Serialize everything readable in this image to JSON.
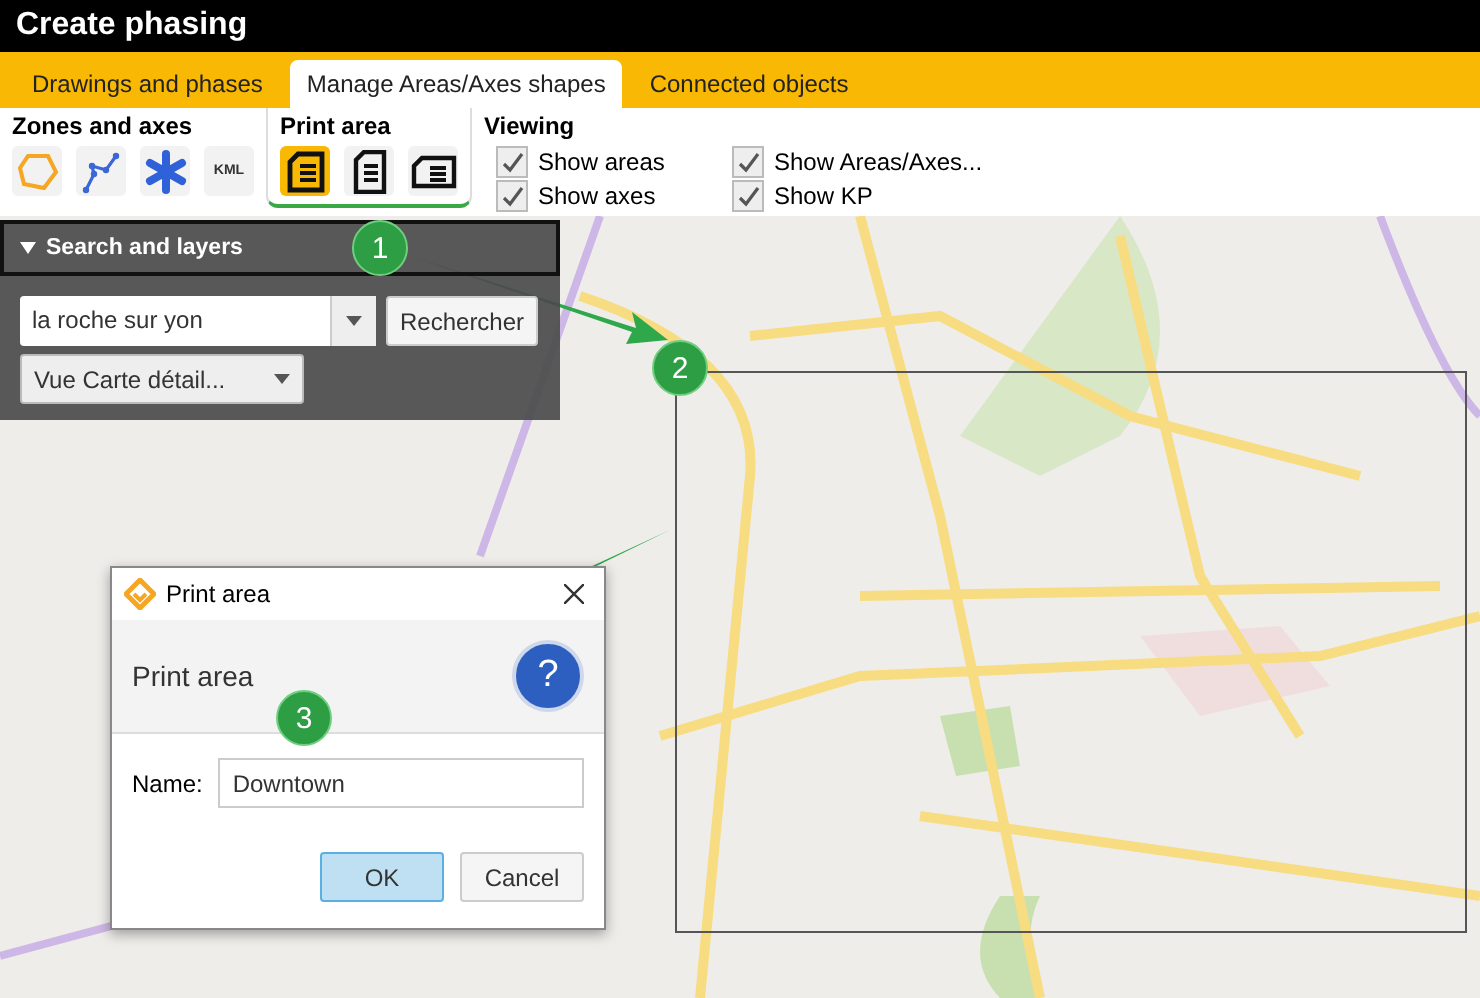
{
  "window": {
    "title": "Create phasing"
  },
  "tabs": [
    {
      "label": "Drawings and phases",
      "selected": false
    },
    {
      "label": "Manage Areas/Axes shapes",
      "selected": true
    },
    {
      "label": "Connected objects",
      "selected": false
    }
  ],
  "ribbon": {
    "groups": [
      {
        "title": "Zones and axes",
        "tools": [
          {
            "kind": "polygon",
            "selected": false
          },
          {
            "kind": "polyline",
            "selected": false
          },
          {
            "kind": "point",
            "selected": false
          },
          {
            "kind": "kml",
            "label": "KML",
            "selected": false
          }
        ]
      },
      {
        "title": "Print area",
        "tools": [
          {
            "kind": "area-list",
            "selected": true
          },
          {
            "kind": "page",
            "selected": false
          },
          {
            "kind": "card",
            "selected": false
          }
        ]
      }
    ],
    "viewing": {
      "title": "Viewing",
      "options": [
        {
          "label": "Show areas",
          "checked": true
        },
        {
          "label": "Show axes",
          "checked": true
        },
        {
          "label": "Show Areas/Axes...",
          "checked": true
        },
        {
          "label": "Show KP",
          "checked": true
        }
      ]
    }
  },
  "search_panel": {
    "title": "Search and layers",
    "expanded": true,
    "query": "la roche sur yon",
    "search_button": "Rechercher",
    "layer": "Vue Carte détail..."
  },
  "callouts": [
    {
      "label": "1"
    },
    {
      "label": "2"
    },
    {
      "label": "3"
    }
  ],
  "dialog": {
    "title": "Print area",
    "heading": "Print area",
    "help": "?",
    "name_label": "Name:",
    "name_value": "Downtown",
    "buttons": [
      {
        "label": "OK",
        "default": true
      },
      {
        "label": "Cancel",
        "default": false
      }
    ]
  }
}
